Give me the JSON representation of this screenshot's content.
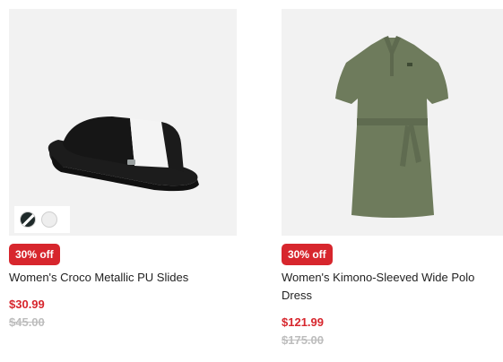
{
  "products": [
    {
      "discount_badge": "30% off",
      "name": "Women's Croco Metallic PU Slides",
      "price": "$30.99",
      "original_price": "$45.00",
      "image": "black-white-slide-sandal",
      "swatches": [
        "black-white",
        "white"
      ]
    },
    {
      "discount_badge": "30% off",
      "name": "Women's Kimono-Sleeved Wide Polo Dress",
      "price": "$121.99",
      "original_price": "$175.00",
      "image": "olive-green-polo-dress"
    }
  ],
  "colors": {
    "badge": "#d7262d",
    "price": "#d7262d",
    "original_price": "#bdbdbd",
    "dress": "#6e7b5c"
  }
}
